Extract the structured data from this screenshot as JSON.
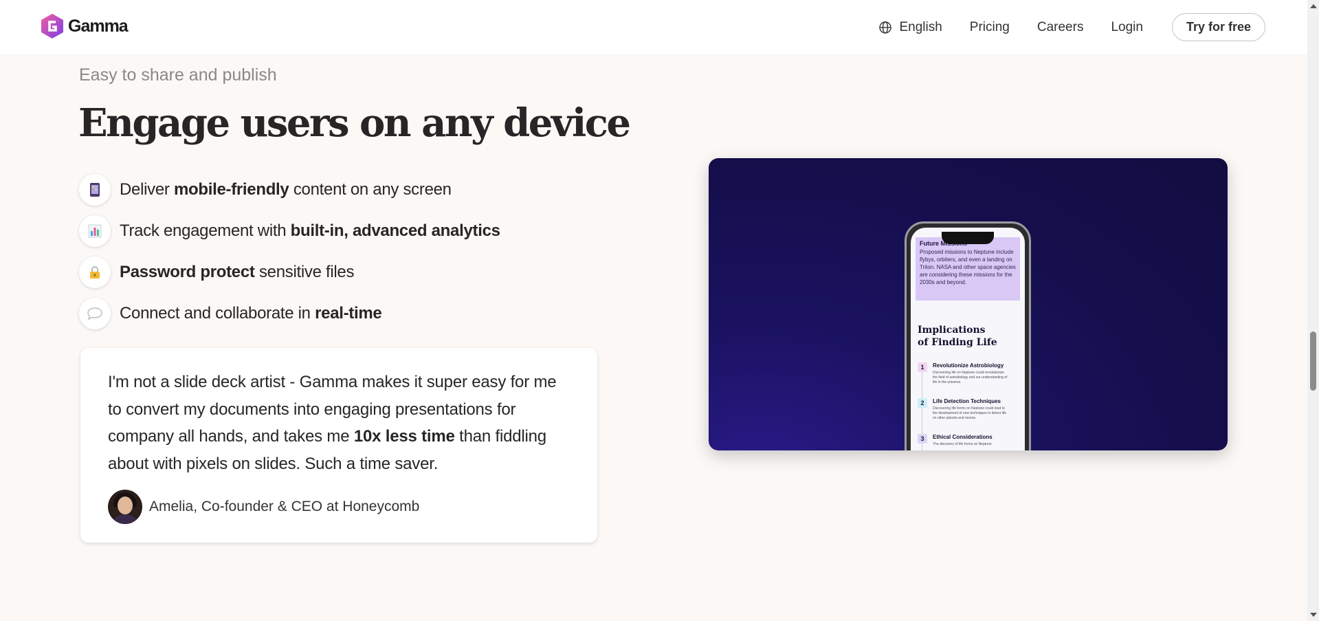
{
  "header": {
    "brand": "Gamma",
    "nav": [
      {
        "label": "English",
        "icon": "globe-icon"
      },
      {
        "label": "Pricing"
      },
      {
        "label": "Careers"
      },
      {
        "label": "Login"
      }
    ],
    "cta": "Try for free"
  },
  "section": {
    "eyebrow": "Easy to share and publish",
    "headline": "Engage users on any device",
    "features": [
      {
        "icon": "mobile-phone-icon",
        "pre": "Deliver ",
        "bold": "mobile-friendly",
        "post": " content on any screen"
      },
      {
        "icon": "bar-chart-icon",
        "pre": "Track engagement with ",
        "bold": "built-in, advanced analytics",
        "post": ""
      },
      {
        "icon": "lock-icon",
        "pre": "",
        "bold": "Password protect",
        "post": " sensitive files"
      },
      {
        "icon": "speech-bubble-icon",
        "pre": "Connect and collaborate in ",
        "bold": "real-time",
        "post": ""
      }
    ]
  },
  "testimonial": {
    "quote_pre": "I'm not a slide deck artist - Gamma makes it super easy for me to convert my documents into engaging presentations for company all hands, and takes me ",
    "quote_bold": "10x less time",
    "quote_post": " than fiddling about with pixels on slides. Such a time saver.",
    "author": "Amelia, Co-founder & CEO at Honeycomb"
  },
  "phone": {
    "card_title": "Future Missions",
    "card_body": "Proposed missions to Neptune include flybys, orbiters, and even a landing on Triton. NASA and other space agencies are considering these missions for the 2030s and beyond.",
    "section_title_line1": "Implications",
    "section_title_line2": "of Finding Life",
    "steps": [
      {
        "num": "1",
        "title": "Revolutionize Astrobiology",
        "body": "Discovering life on Neptune could revolutionize the field of astrobiology and our understanding of life in the universe.",
        "color": "#f1d6f0"
      },
      {
        "num": "2",
        "title": "Life Detection Techniques",
        "body": "Discovering life forms on Neptune could lead to the development of new techniques to detect life on other planets and moons.",
        "color": "#cdeef6"
      },
      {
        "num": "3",
        "title": "Ethical Considerations",
        "body": "The discovery of life forms on Neptune",
        "color": "#dcd6f6"
      }
    ]
  },
  "colors": {
    "background": "#fbf8f6",
    "media_background": "#150e4a",
    "brand_gradient": [
      "#f25fa0",
      "#7b3fe4"
    ]
  }
}
